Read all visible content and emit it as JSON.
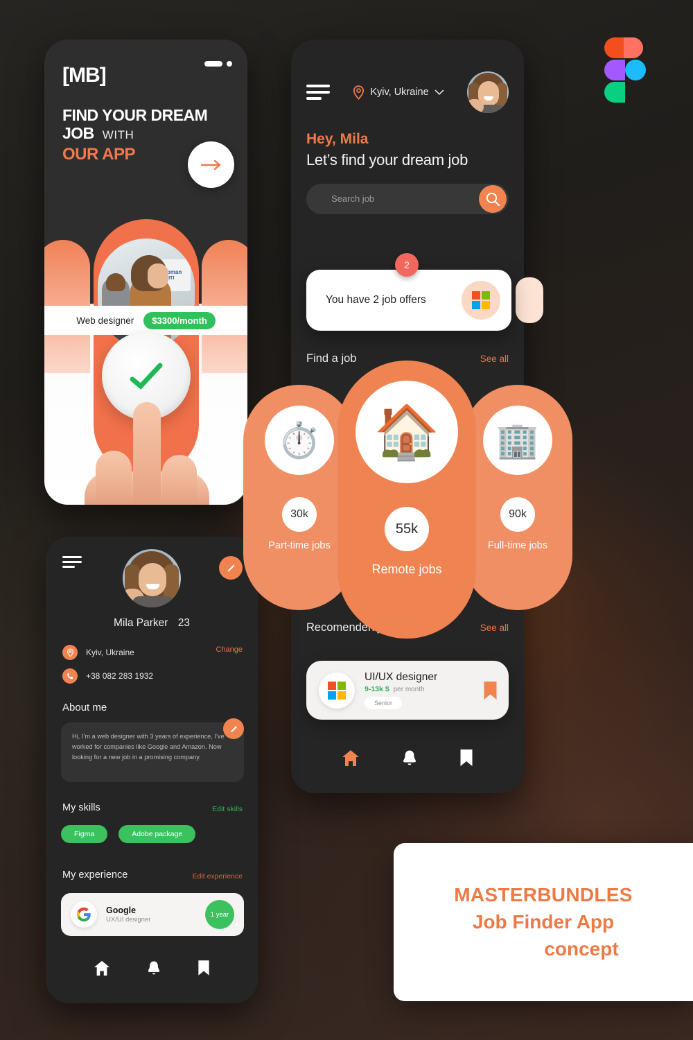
{
  "onboarding": {
    "logo": "[MB]",
    "headline_line1": "FIND YOUR DREAM",
    "headline_line2": "JOB",
    "headline_with": "WITH",
    "headline_line3": "OUR APP",
    "next_icon": "arrow-right-icon",
    "job_title": "Web designer",
    "job_salary": "$3300/month",
    "confirm_icon": "check-icon"
  },
  "home": {
    "menu_icon": "hamburger-menu-icon",
    "location_icon": "location-pin-icon",
    "location": "Kyiv, Ukraine",
    "location_chevron": "chevron-down-icon",
    "avatar": "user-avatar",
    "greeting": "Hey, Mila",
    "subtitle": "Let’s find your dream job",
    "search": {
      "placeholder": "Search job",
      "button_icon": "search-icon"
    },
    "offers": {
      "text": "You have 2 job offers",
      "badge_count": "2",
      "company_icon": "microsoft-logo-icon"
    },
    "find_a_job": {
      "title": "Find a job",
      "see_all": "See all",
      "categories": [
        {
          "icon": "stopwatch-icon",
          "emoji": "⏱️",
          "count": "30k",
          "label": "Part-time  jobs"
        },
        {
          "icon": "house-icon",
          "emoji": "🏠",
          "count": "55k",
          "label": "Remote jobs"
        },
        {
          "icon": "office-building-icon",
          "emoji": "🏢",
          "count": "90k",
          "label": "Full-time  jobs"
        }
      ]
    },
    "recommended": {
      "title": "Recomenden job list",
      "see_all": "See all",
      "jobs": [
        {
          "company_icon": "microsoft-logo-icon",
          "title": "UI/UX designer",
          "pay": "9-13k $",
          "pay_period": "per month",
          "level": "Senior",
          "bookmark_icon": "bookmark-icon"
        }
      ]
    },
    "nav": [
      {
        "icon": "home-icon",
        "active": true
      },
      {
        "icon": "bell-icon",
        "active": false
      },
      {
        "icon": "bookmark-icon",
        "active": false
      }
    ]
  },
  "profile": {
    "menu_icon": "hamburger-menu-icon",
    "edit_icon": "pencil-icon",
    "avatar": "user-avatar",
    "name": "Mila Parker",
    "age": "23",
    "location_icon": "location-pin-icon",
    "location": "Kyiv, Ukraine",
    "change_label": "Change",
    "phone_icon": "phone-icon",
    "phone": "+38 082 283 1932",
    "about_heading": "About me",
    "about_edit_icon": "pencil-icon",
    "bio": "Hi, I’m a web designer with 3 years of experience, I’ve worked for companies like Google and Amazon. Now looking for a new job in a promising company.",
    "skills_heading": "My skills",
    "skills_action": "Edit skills",
    "skills": [
      "Figma",
      "Adobe package"
    ],
    "experience_heading": "My experience",
    "experience_action": "Edit experience",
    "experience": [
      {
        "logo_icon": "google-logo-icon",
        "company": "Google",
        "role": "UX/UI designer",
        "duration": "1 year"
      }
    ],
    "nav": [
      {
        "icon": "home-icon",
        "active": false
      },
      {
        "icon": "bell-icon",
        "active": false
      },
      {
        "icon": "bookmark-icon",
        "active": false
      }
    ]
  },
  "branding": {
    "figma_logo": "figma-logo-icon",
    "card_line1": "MASTERBUNDLES",
    "card_line2": "Job Finder App",
    "card_line3": "concept"
  },
  "colors": {
    "accent_orange": "#f0834f",
    "accent_orange_dark": "#ed7a45",
    "green": "#3cc15f",
    "badge_red": "#f2675e",
    "card_white": "#ffffff",
    "phone_dark": "#252525",
    "canvas_dark": "#201e1b"
  }
}
